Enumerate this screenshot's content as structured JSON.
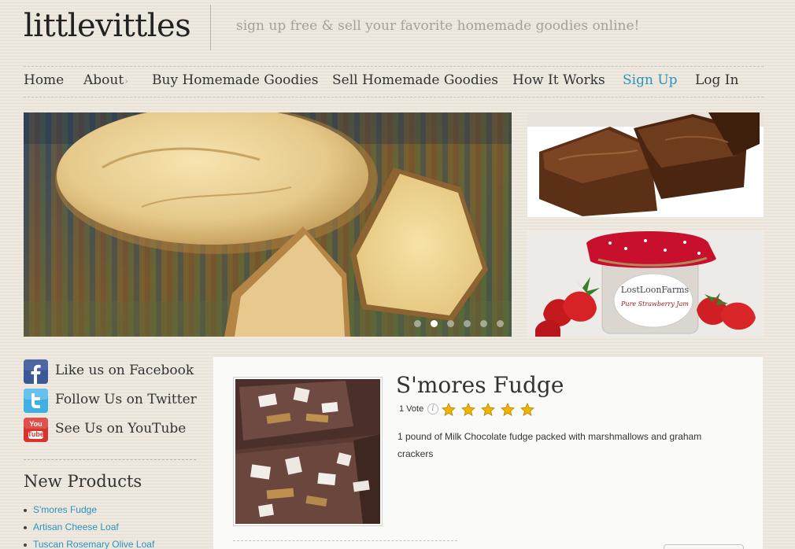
{
  "site": {
    "logo": "littlevittles",
    "tagline": "sign up free & sell your favorite homemade goodies online!"
  },
  "nav": {
    "items": [
      {
        "label": "Home"
      },
      {
        "label": "About",
        "has_dropdown": true,
        "dropdown_icon": "chevron-right-icon"
      },
      {
        "label": "Buy Homemade Goodies"
      },
      {
        "label": "Sell Homemade Goodies"
      },
      {
        "label": "How It Works"
      },
      {
        "label": "Sign Up",
        "active": true
      },
      {
        "label": "Log In"
      }
    ]
  },
  "slider": {
    "slide_count": 6,
    "active_slide": 2
  },
  "social": {
    "items": [
      {
        "label": "Like us on Facebook",
        "icon": "facebook-icon"
      },
      {
        "label": "Follow Us on Twitter",
        "icon": "twitter-icon"
      },
      {
        "label": "See Us on YouTube",
        "icon": "youtube-icon",
        "icon_text_top": "You",
        "icon_text_bottom": "Tube"
      }
    ]
  },
  "new_products": {
    "title": "New Products",
    "items": [
      "S'mores Fudge",
      "Artisan Cheese Loaf",
      "Tuscan Rosemary Olive Loaf"
    ]
  },
  "product": {
    "title": "S'mores Fudge",
    "votes": "1 Vote",
    "info_icon": "info-icon",
    "rating": 5,
    "max_rating": 5,
    "description": "1 pound of Milk Chocolate fudge packed with marshmallows and graham crackers"
  },
  "colors": {
    "link": "#2a93bf",
    "background": "#efe9de",
    "star": "#f2b400"
  }
}
